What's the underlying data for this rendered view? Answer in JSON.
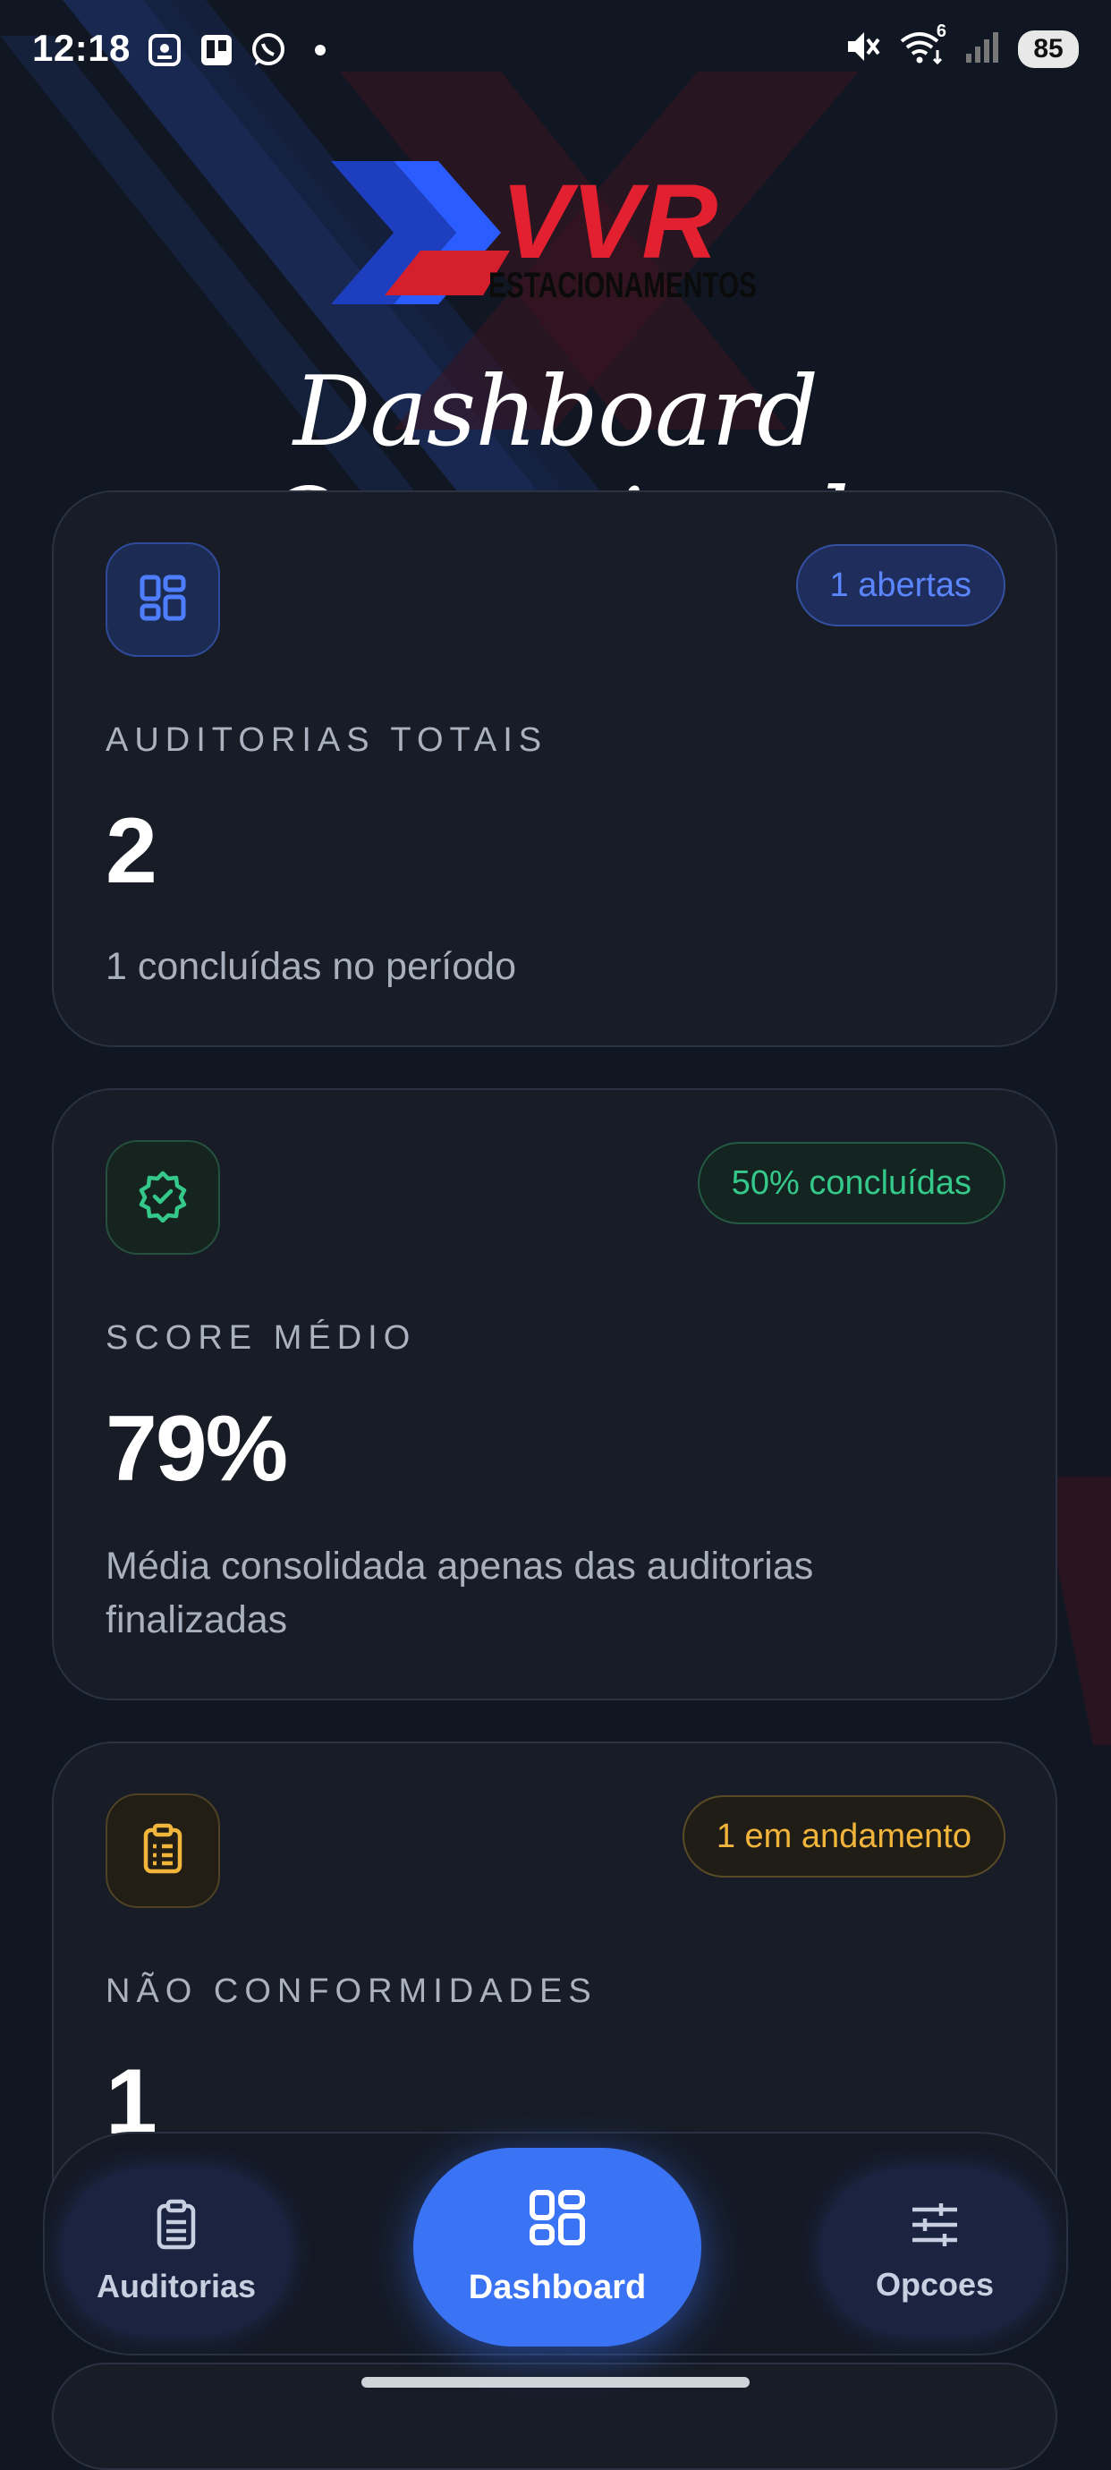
{
  "status_bar": {
    "time": "12:18",
    "left_icons": [
      "screenshot-icon",
      "trello-icon",
      "whatsapp-icon",
      "notification-dot"
    ],
    "right_icons": [
      "mute-icon",
      "wifi-icon",
      "signal-icon"
    ],
    "wifi_label": "6",
    "battery": "85"
  },
  "logo": {
    "brand": "VVR",
    "tagline": "ESTACIONAMENTOS"
  },
  "page": {
    "title": "Dashboard Operacional"
  },
  "cards": [
    {
      "icon": "grid-icon",
      "badge": "1 abertas",
      "label": "AUDITORIAS TOTAIS",
      "value": "2",
      "sub": "1 concluídas no período",
      "accent": "#4f7dff"
    },
    {
      "icon": "verified-badge-icon",
      "badge": "50% concluídas",
      "label": "SCORE MÉDIO",
      "value": "79%",
      "sub": "Média consolidada apenas das auditorias finalizadas",
      "accent": "#34c98a"
    },
    {
      "icon": "clipboard-icon",
      "badge": "1 em andamento",
      "label": "NÃO CONFORMIDADES",
      "value": "1",
      "sub": "",
      "accent": "#f2b53c"
    }
  ],
  "bottom_nav": {
    "items": [
      {
        "label": "Auditorias",
        "icon": "clipboard-icon",
        "active": false
      },
      {
        "label": "Dashboard",
        "icon": "grid-icon",
        "active": true
      },
      {
        "label": "Opcoes",
        "icon": "sliders-icon",
        "active": false
      }
    ]
  },
  "colors": {
    "background": "#111722",
    "card": "#171c26",
    "primary": "#3b73f5"
  }
}
